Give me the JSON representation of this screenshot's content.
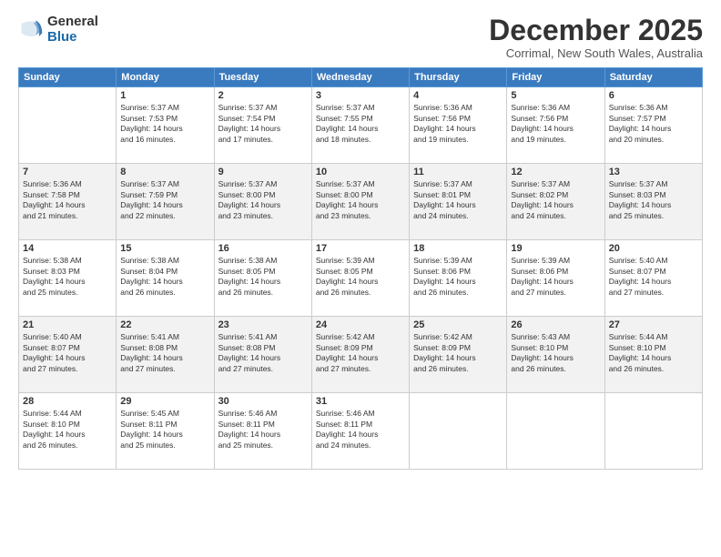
{
  "logo": {
    "general": "General",
    "blue": "Blue"
  },
  "title": "December 2025",
  "subtitle": "Corrimal, New South Wales, Australia",
  "headers": [
    "Sunday",
    "Monday",
    "Tuesday",
    "Wednesday",
    "Thursday",
    "Friday",
    "Saturday"
  ],
  "weeks": [
    [
      {
        "day": "",
        "info": ""
      },
      {
        "day": "1",
        "info": "Sunrise: 5:37 AM\nSunset: 7:53 PM\nDaylight: 14 hours\nand 16 minutes."
      },
      {
        "day": "2",
        "info": "Sunrise: 5:37 AM\nSunset: 7:54 PM\nDaylight: 14 hours\nand 17 minutes."
      },
      {
        "day": "3",
        "info": "Sunrise: 5:37 AM\nSunset: 7:55 PM\nDaylight: 14 hours\nand 18 minutes."
      },
      {
        "day": "4",
        "info": "Sunrise: 5:36 AM\nSunset: 7:56 PM\nDaylight: 14 hours\nand 19 minutes."
      },
      {
        "day": "5",
        "info": "Sunrise: 5:36 AM\nSunset: 7:56 PM\nDaylight: 14 hours\nand 19 minutes."
      },
      {
        "day": "6",
        "info": "Sunrise: 5:36 AM\nSunset: 7:57 PM\nDaylight: 14 hours\nand 20 minutes."
      }
    ],
    [
      {
        "day": "7",
        "info": "Sunrise: 5:36 AM\nSunset: 7:58 PM\nDaylight: 14 hours\nand 21 minutes."
      },
      {
        "day": "8",
        "info": "Sunrise: 5:37 AM\nSunset: 7:59 PM\nDaylight: 14 hours\nand 22 minutes."
      },
      {
        "day": "9",
        "info": "Sunrise: 5:37 AM\nSunset: 8:00 PM\nDaylight: 14 hours\nand 23 minutes."
      },
      {
        "day": "10",
        "info": "Sunrise: 5:37 AM\nSunset: 8:00 PM\nDaylight: 14 hours\nand 23 minutes."
      },
      {
        "day": "11",
        "info": "Sunrise: 5:37 AM\nSunset: 8:01 PM\nDaylight: 14 hours\nand 24 minutes."
      },
      {
        "day": "12",
        "info": "Sunrise: 5:37 AM\nSunset: 8:02 PM\nDaylight: 14 hours\nand 24 minutes."
      },
      {
        "day": "13",
        "info": "Sunrise: 5:37 AM\nSunset: 8:03 PM\nDaylight: 14 hours\nand 25 minutes."
      }
    ],
    [
      {
        "day": "14",
        "info": "Sunrise: 5:38 AM\nSunset: 8:03 PM\nDaylight: 14 hours\nand 25 minutes."
      },
      {
        "day": "15",
        "info": "Sunrise: 5:38 AM\nSunset: 8:04 PM\nDaylight: 14 hours\nand 26 minutes."
      },
      {
        "day": "16",
        "info": "Sunrise: 5:38 AM\nSunset: 8:05 PM\nDaylight: 14 hours\nand 26 minutes."
      },
      {
        "day": "17",
        "info": "Sunrise: 5:39 AM\nSunset: 8:05 PM\nDaylight: 14 hours\nand 26 minutes."
      },
      {
        "day": "18",
        "info": "Sunrise: 5:39 AM\nSunset: 8:06 PM\nDaylight: 14 hours\nand 26 minutes."
      },
      {
        "day": "19",
        "info": "Sunrise: 5:39 AM\nSunset: 8:06 PM\nDaylight: 14 hours\nand 27 minutes."
      },
      {
        "day": "20",
        "info": "Sunrise: 5:40 AM\nSunset: 8:07 PM\nDaylight: 14 hours\nand 27 minutes."
      }
    ],
    [
      {
        "day": "21",
        "info": "Sunrise: 5:40 AM\nSunset: 8:07 PM\nDaylight: 14 hours\nand 27 minutes."
      },
      {
        "day": "22",
        "info": "Sunrise: 5:41 AM\nSunset: 8:08 PM\nDaylight: 14 hours\nand 27 minutes."
      },
      {
        "day": "23",
        "info": "Sunrise: 5:41 AM\nSunset: 8:08 PM\nDaylight: 14 hours\nand 27 minutes."
      },
      {
        "day": "24",
        "info": "Sunrise: 5:42 AM\nSunset: 8:09 PM\nDaylight: 14 hours\nand 27 minutes."
      },
      {
        "day": "25",
        "info": "Sunrise: 5:42 AM\nSunset: 8:09 PM\nDaylight: 14 hours\nand 26 minutes."
      },
      {
        "day": "26",
        "info": "Sunrise: 5:43 AM\nSunset: 8:10 PM\nDaylight: 14 hours\nand 26 minutes."
      },
      {
        "day": "27",
        "info": "Sunrise: 5:44 AM\nSunset: 8:10 PM\nDaylight: 14 hours\nand 26 minutes."
      }
    ],
    [
      {
        "day": "28",
        "info": "Sunrise: 5:44 AM\nSunset: 8:10 PM\nDaylight: 14 hours\nand 26 minutes."
      },
      {
        "day": "29",
        "info": "Sunrise: 5:45 AM\nSunset: 8:11 PM\nDaylight: 14 hours\nand 25 minutes."
      },
      {
        "day": "30",
        "info": "Sunrise: 5:46 AM\nSunset: 8:11 PM\nDaylight: 14 hours\nand 25 minutes."
      },
      {
        "day": "31",
        "info": "Sunrise: 5:46 AM\nSunset: 8:11 PM\nDaylight: 14 hours\nand 24 minutes."
      },
      {
        "day": "",
        "info": ""
      },
      {
        "day": "",
        "info": ""
      },
      {
        "day": "",
        "info": ""
      }
    ]
  ]
}
